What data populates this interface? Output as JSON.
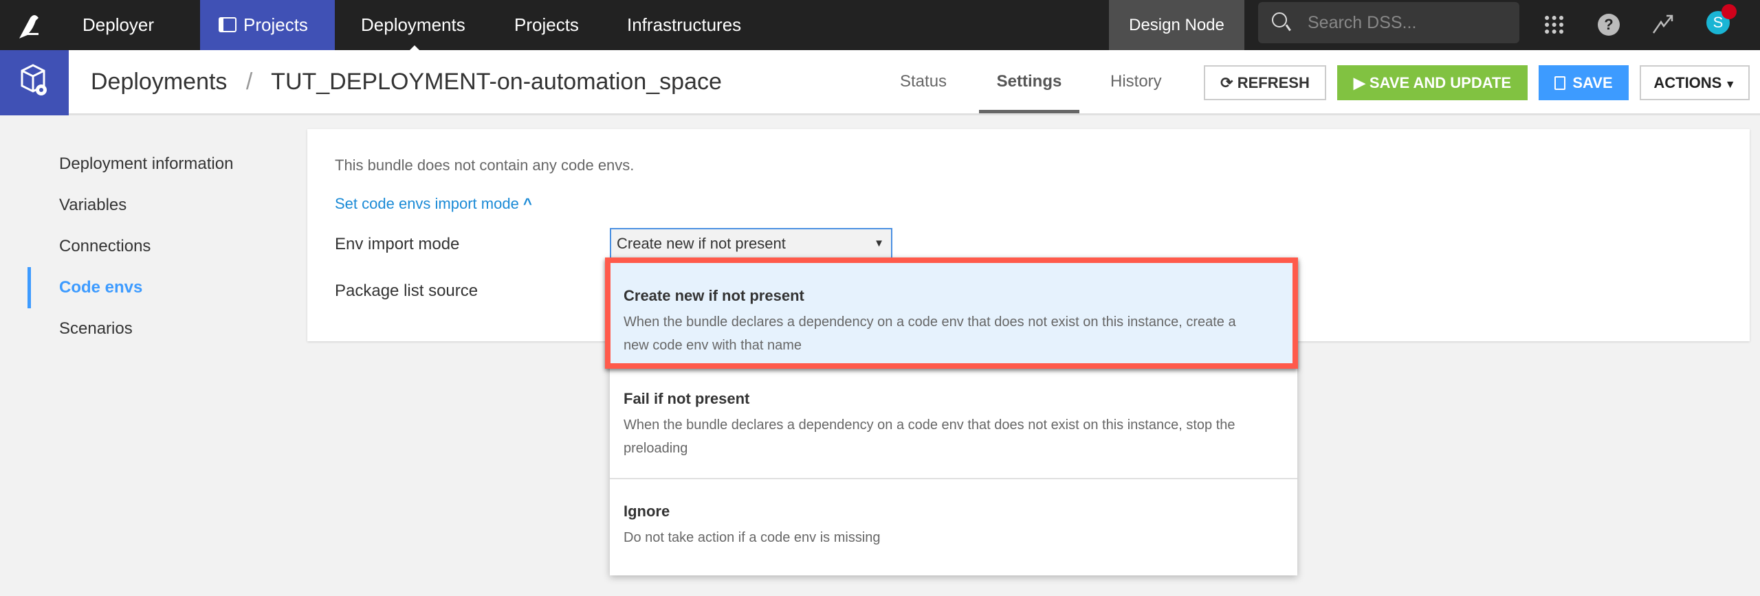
{
  "topbar": {
    "app": "Deployer",
    "nav": [
      "Projects",
      "Deployments",
      "Projects",
      "Infrastructures"
    ],
    "node": "Design Node",
    "search_placeholder": "Search DSS...",
    "avatar": "S"
  },
  "header": {
    "section": "Deployments",
    "separator": "/",
    "title": "TUT_DEPLOYMENT-on-automation_space",
    "tabs": [
      "Status",
      "Settings",
      "History"
    ],
    "refresh": "REFRESH",
    "save_update": "SAVE AND UPDATE",
    "save": "SAVE",
    "actions": "ACTIONS"
  },
  "sidebar": [
    "Deployment information",
    "Variables",
    "Connections",
    "Code envs",
    "Scenarios"
  ],
  "panel": {
    "info": "This bundle does not contain any code envs.",
    "link": "Set code envs import mode",
    "env_label": "Env import mode",
    "env_value": "Create new if not present",
    "pkg_label": "Package list source"
  },
  "dropdown": [
    {
      "title": "Create new if not present",
      "desc": "When the bundle declares a dependency on a code env that does not exist on this instance, create a new code env with that name"
    },
    {
      "title": "Fail if not present",
      "desc": "When the bundle declares a dependency on a code env that does not exist on this instance, stop the preloading"
    },
    {
      "title": "Ignore",
      "desc": "Do not take action if a code env is missing"
    }
  ],
  "colors": {
    "brand": "#4051b5",
    "green": "#81c241",
    "blue": "#3d9bff",
    "highlight": "#ff5a4b"
  }
}
